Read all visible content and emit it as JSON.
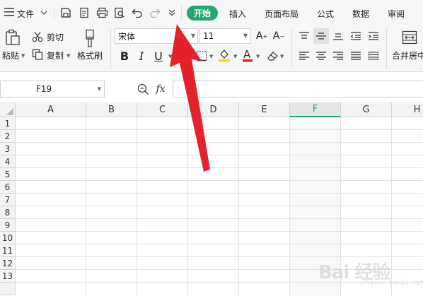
{
  "topbar": {
    "file_menu": "文件",
    "tabs": [
      "开始",
      "插入",
      "页面布局",
      "公式",
      "数据",
      "审阅"
    ],
    "active_tab": "开始",
    "accent": "#1fa870"
  },
  "ribbon": {
    "paste_label": "粘贴",
    "cut_label": "剪切",
    "copy_label": "复制",
    "format_painter_label": "格式刷",
    "font_name": "宋体",
    "font_size": "11",
    "merge_label": "合并居中",
    "bold": "B",
    "italic": "I",
    "underline": "U",
    "font_color": "#e0242b",
    "highlight_color": "#f5d90a"
  },
  "formula_bar": {
    "cell_ref": "F19",
    "fx": "fx"
  },
  "grid": {
    "columns": [
      "A",
      "B",
      "C",
      "D",
      "E",
      "F",
      "G",
      "H"
    ],
    "selected_column": "F",
    "rows": [
      "1",
      "2",
      "3",
      "4",
      "5",
      "6",
      "7",
      "8",
      "9",
      "10",
      "11",
      "12",
      "13"
    ]
  },
  "annotation": {
    "arrow_color": "#e5222b"
  },
  "watermark": {
    "text": "Bai 经验",
    "subtext": "jingyan.baidu.com"
  }
}
